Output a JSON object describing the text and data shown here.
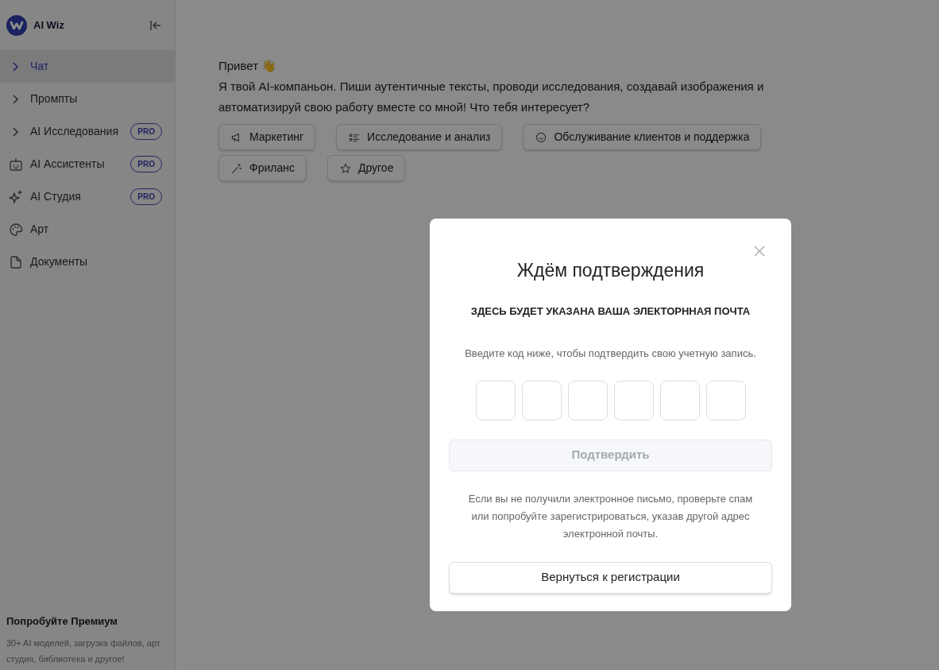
{
  "sidebar": {
    "brand": "AI Wiz",
    "items": [
      {
        "label": "Чат",
        "kind": "expandable",
        "selected": true
      },
      {
        "label": "Промпты",
        "kind": "expandable",
        "selected": false
      },
      {
        "label": "AI Исследования",
        "kind": "expandable",
        "selected": false,
        "badge": "PRO"
      },
      {
        "label": "AI Ассистенты",
        "kind": "link",
        "selected": false,
        "badge": "PRO"
      },
      {
        "label": "AI Студия",
        "kind": "link",
        "selected": false,
        "badge": "PRO"
      },
      {
        "label": "Арт",
        "kind": "link",
        "selected": false
      },
      {
        "label": "Документы",
        "kind": "link",
        "selected": false
      }
    ],
    "promo": {
      "title": "Попробуйте Премиум",
      "text": "30+ AI моделей, загрузка файлов, арт студия, библиотека и другое!"
    }
  },
  "chat": {
    "greeting": "Привет 👋",
    "intro": "Я твой AI-компаньон. Пиши аутентичные тексты, проводи исследования, создавай изображения и автоматизируй свою работу вместе со мной! Что тебя интересует?",
    "topics": [
      {
        "label": "Маркетинг"
      },
      {
        "label": "Исследование и анализ"
      },
      {
        "label": "Обслуживание клиентов и поддержка"
      },
      {
        "label": "Фриланс"
      },
      {
        "label": "Другое"
      }
    ]
  },
  "modal": {
    "title": "Ждём подтверждения",
    "email": "ЗДЕСЬ БУДЕТ УКАЗАНА ВАША ЭЛЕКТОРННАЯ ПОЧТА",
    "instruction": "Введите код ниже, чтобы подтвердить свою учетную запись.",
    "confirm": {
      "label": "Подтвердить",
      "disabled": true
    },
    "note": "Если вы не получили электронное письмо, проверьте спам или попробуйте зарегистрироваться, указав другой адрес электронной почты.",
    "back": "Вернуться к регистрации"
  }
}
